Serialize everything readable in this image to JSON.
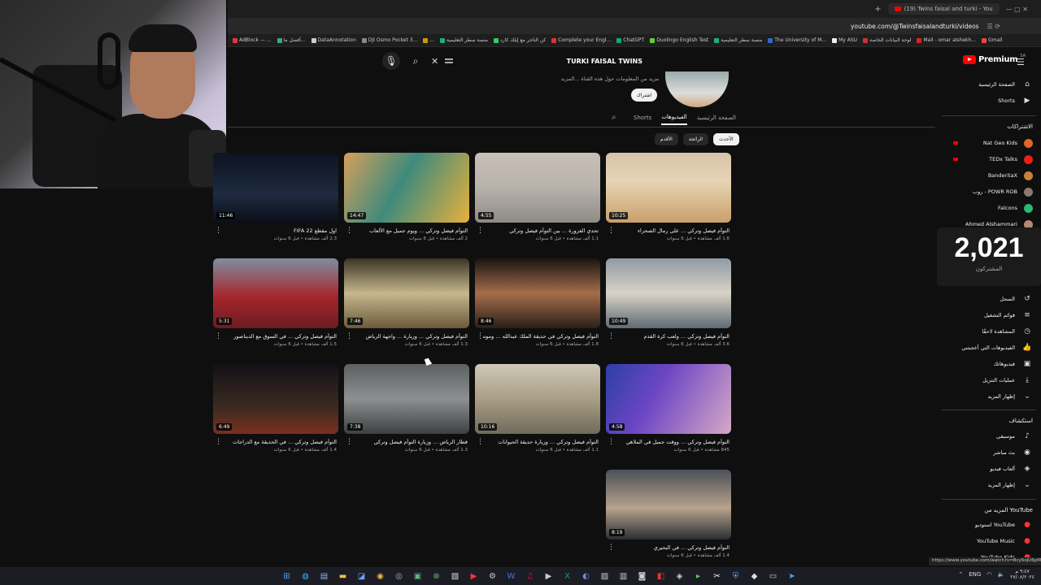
{
  "browser": {
    "tab_title": "(19) Twins faisal and turki - You",
    "url": "youtube.com/@Twinsfaisalandturki/videos",
    "bookmarks": [
      "AdBlock — ...",
      "أفضل ما...",
      "DataAnnotation",
      "DJI Osmo Pocket 3...",
      "...",
      "منصة سطر التعليمية",
      "كن التاجر مع إيلك كارد",
      "Complete your Engl...",
      "ChatGPT",
      "Duolingo English Test",
      "منصة سطر التعليمية",
      "The University of M...",
      "My ASU",
      "لوحة البيانات الخاصة",
      "Mail - omar alshekh...",
      "Gmail"
    ]
  },
  "search": {
    "query": "TURKI FAISAL TWINS"
  },
  "channel": {
    "description": "مزيد من المعلومات حول هذه القناة ...المزيد",
    "subscribe_label": "اشتراك",
    "tabs": [
      "الصفحة الرئيسية",
      "الفيديوهات",
      "Shorts"
    ],
    "active_tab": "الفيديوهات",
    "chips": [
      "الأحدث",
      "الرائجة",
      "الأقدم"
    ]
  },
  "videos": [
    {
      "title": "التوأم فيصل وتركي ... على رمال الصحراء",
      "meta": "1.6 ألف مشاهدة • قبل 6 سنوات",
      "duration": "10:25"
    },
    {
      "title": "تحدي الفزورة ... بين التوأم فيصل وتركي",
      "meta": "1.1 ألف مشاهدة • قبل 6 سنوات",
      "duration": "4:55"
    },
    {
      "title": "التوأم فيصل وتركي ... ويوم جميل مع الألعاب",
      "meta": "2 ألف مشاهدة • قبل 6 سنوات",
      "duration": "14:47"
    },
    {
      "title": "اول مقطع FIFA 22",
      "meta": "2.3 ألف مشاهدة • قبل 6 سنوات",
      "duration": "11:46"
    },
    {
      "title": "التوأم فيصل وتركي ... ولعب كرة القدم",
      "meta": "3.6 ألف مشاهدة • قبل 6 سنوات",
      "duration": "10:49"
    },
    {
      "title": "التوأم فيصل وتركي في حديقة الملك عبدالله ... وموسم الرياض",
      "meta": "1.8 ألف مشاهدة • قبل 6 سنوات",
      "duration": "8:46"
    },
    {
      "title": "التوأم فيصل وتركي ... وزيارة ... واجهة الرياض",
      "meta": "1.3 ألف مشاهدة • قبل 6 سنوات",
      "duration": "7:46"
    },
    {
      "title": "التوأم فيصل وتركي ... في السوق مع الديناصور",
      "meta": "1.5 ألف مشاهدة • قبل 6 سنوات",
      "duration": "5:31"
    },
    {
      "title": "التوأم فيصل وتركي ... ووقت جميل في الملاهي",
      "meta": "845 مشاهدة • قبل 6 سنوات",
      "duration": "4:58"
    },
    {
      "title": "التوأم فيصل وتركي ... وزيارة حديقة الحيوانات",
      "meta": "1.1 ألف مشاهدة • قبل 6 سنوات",
      "duration": "10:16"
    },
    {
      "title": "قطار الرياض ... وزيارة التوأم فيصل وتركي",
      "meta": "1.3 ألف مشاهدة • قبل 6 سنوات",
      "duration": "7:38"
    },
    {
      "title": "التوأم فيصل وتركي ... في الحديقة مع الدراجات",
      "meta": "1.4 ألف مشاهدة • قبل 6 سنوات",
      "duration": "6:49"
    },
    {
      "title": "التوأم فيصل وتركي ... في البحيري",
      "meta": "1.4 ألف مشاهدة • قبل 6 سنوات",
      "duration": "8:19"
    }
  ],
  "sidebar": {
    "logo_text": "Premium",
    "logo_region": "SA",
    "items_top": [
      {
        "label": "الصفحة الرئيسية",
        "icon": "home-icon"
      },
      {
        "label": "Shorts",
        "icon": "shorts-icon"
      }
    ],
    "subscriptions_heading": "الاشتراكات",
    "subscriptions": [
      {
        "label": "Nat Geo Kids",
        "color": "#e0642c",
        "live": true
      },
      {
        "label": "TEDx Talks",
        "color": "#e62117",
        "live": true
      },
      {
        "label": "BanderitaX",
        "color": "#c9823a",
        "live": false
      },
      {
        "label": "روب - POWR ROB",
        "color": "#8a7a70",
        "live": false
      },
      {
        "label": "Falcons",
        "color": "#2bb673",
        "live": false
      },
      {
        "label": "Ahmed Alshammari",
        "color": "#b58a6a",
        "live": false
      }
    ],
    "subscriber_count": "2,021",
    "subscriber_label": "المشتركون",
    "you_items": [
      {
        "label": "السجل",
        "icon": "history-icon"
      },
      {
        "label": "قوائم التشغيل",
        "icon": "playlist-icon"
      },
      {
        "label": "المشاهدة لاحقًا",
        "icon": "clock-icon"
      },
      {
        "label": "الفيديوهات التي أعجبتني",
        "icon": "like-icon"
      },
      {
        "label": "فيديوهاتك",
        "icon": "video-icon"
      },
      {
        "label": "عمليات التنزيل",
        "icon": "download-icon"
      },
      {
        "label": "إظهار المزيد",
        "icon": "chevron-down-icon"
      }
    ],
    "explore_heading": "استكشاف",
    "explore_items": [
      {
        "label": "موسيقى",
        "icon": "music-icon"
      },
      {
        "label": "بث مباشر",
        "icon": "live-icon"
      },
      {
        "label": "ألعاب فيديو",
        "icon": "gaming-icon"
      },
      {
        "label": "إظهار المزيد",
        "icon": "chevron-down-icon"
      }
    ],
    "more_heading": "المزيد من YouTube",
    "more_items": [
      {
        "label": "استوديو YouTube",
        "icon": "studio-icon"
      },
      {
        "label": "YouTube Music",
        "icon": "yt-music-icon"
      },
      {
        "label": "YouTube Kids",
        "icon": "yt-kids-icon"
      }
    ]
  },
  "status_url": "https://www.youtube.com/watch?v=Bcy6oJU6pM",
  "taskbar": {
    "lang": "ENG",
    "time": "٩:٤٧ م",
    "date": "٢٧/٠٨/٢٠٢٤"
  }
}
